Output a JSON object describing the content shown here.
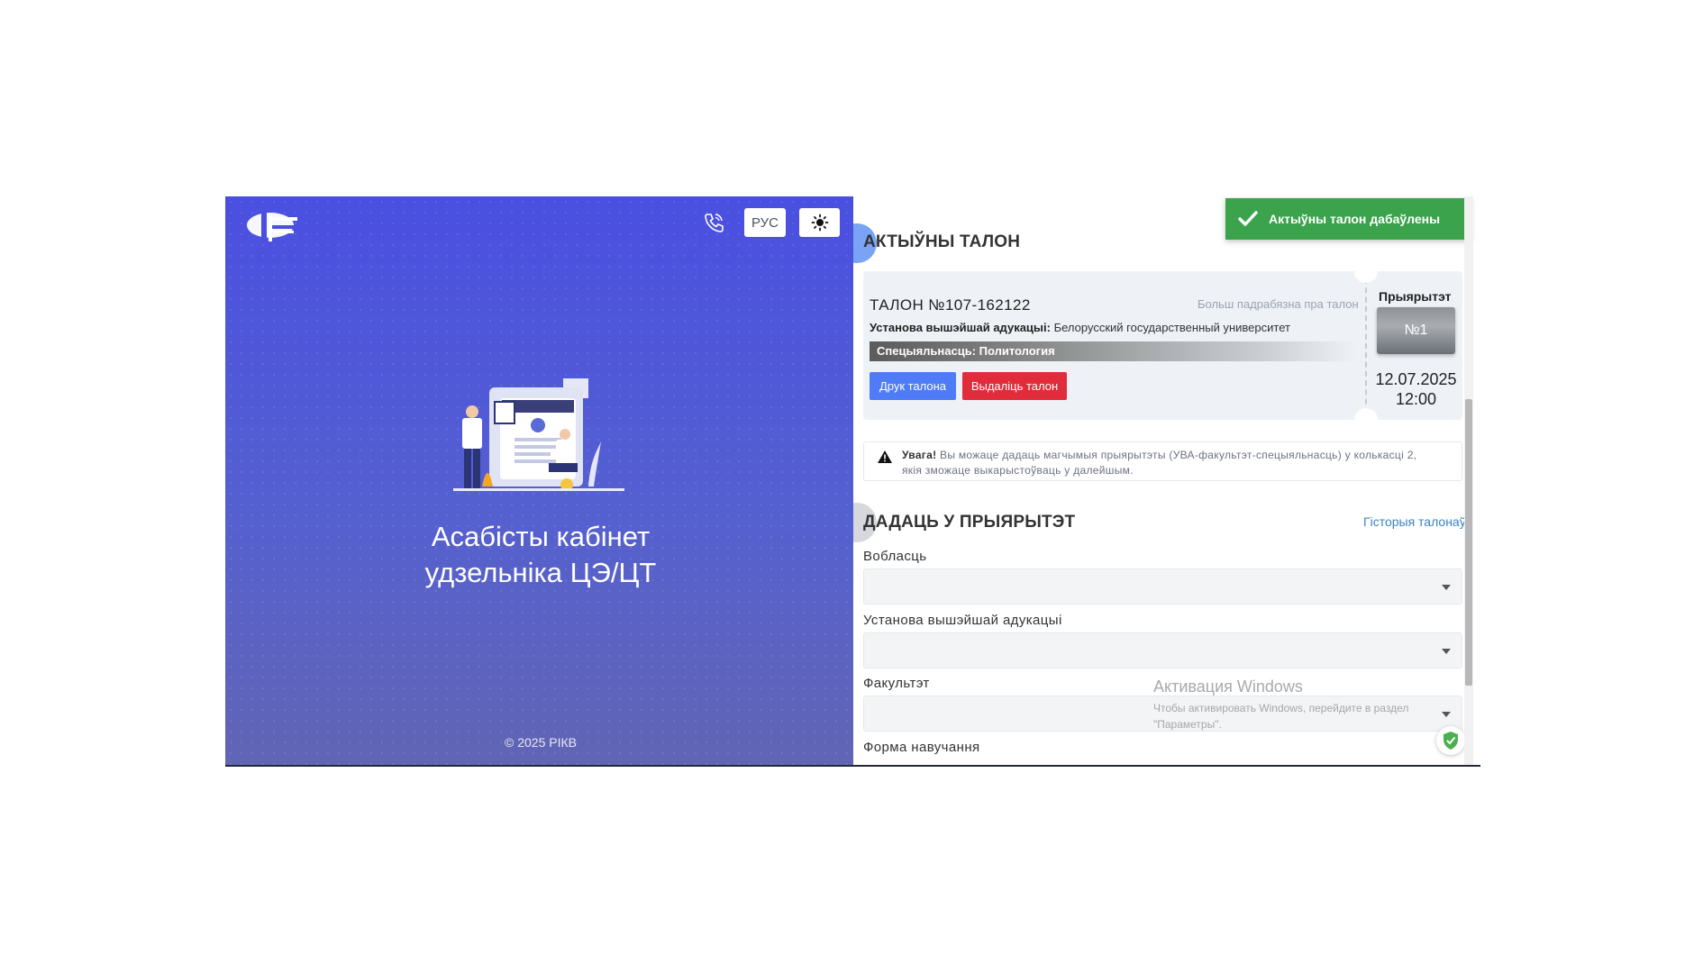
{
  "header": {
    "lang_label": "РУС",
    "icons": {
      "phone": "phone-icon",
      "theme": "sun-icon",
      "logo": "logo-icon"
    }
  },
  "hero": {
    "title_line1": "Асабісты кабінет",
    "title_line2": "удзельніка ЦЭ/ЦТ",
    "copyright": "© 2025 РІКВ"
  },
  "toast": {
    "text": "Актыўны талон дабаўлены"
  },
  "active_ticket": {
    "section_title": "АКТЫЎНЫ ТАЛОН",
    "number": "ТАЛОН №107-162122",
    "more_link": "Больш падрабязна пра талон",
    "institution_label": "Установа вышэйшай адукацыі:",
    "institution_value": "Белорусский государственный университет",
    "specialty": "Спецыяльнасць: Политология",
    "print_label": "Друк талона",
    "delete_label": "Выдаліць талон",
    "priority_label": "Прыярытэт",
    "priority_value": "№1",
    "date": "12.07.2025",
    "time": "12:00"
  },
  "warning": {
    "title": "Увага!",
    "text_line1": "Вы можаце дадаць магчымыя прыярытэты (УВА-факультэт-спецыяльнасць) у колькасці 2,",
    "text_line2": "якія зможаце выкарыстоўваць у далейшым."
  },
  "add_priority": {
    "section_title": "ДАДАЦЬ У ПРЫЯРЫТЭТ",
    "history_link": "Гісторыя талонаў",
    "fields": [
      {
        "label": "Вобласць",
        "value": ""
      },
      {
        "label": "Установа вышэйшай адукацыі",
        "value": ""
      },
      {
        "label": "Факультэт",
        "value": ""
      },
      {
        "label": "Форма навучання"
      }
    ]
  },
  "watermark": {
    "line1": "Активация Windows",
    "line2": "Чтобы активировать Windows, перейдите в раздел",
    "line3": "\"Параметры\"."
  },
  "colors": {
    "left_bg": "#4a4fe0",
    "toast": "#3aa34b",
    "print_btn": "#4f7cf6",
    "delete_btn": "#e02c3b",
    "link": "#3b82c4"
  }
}
